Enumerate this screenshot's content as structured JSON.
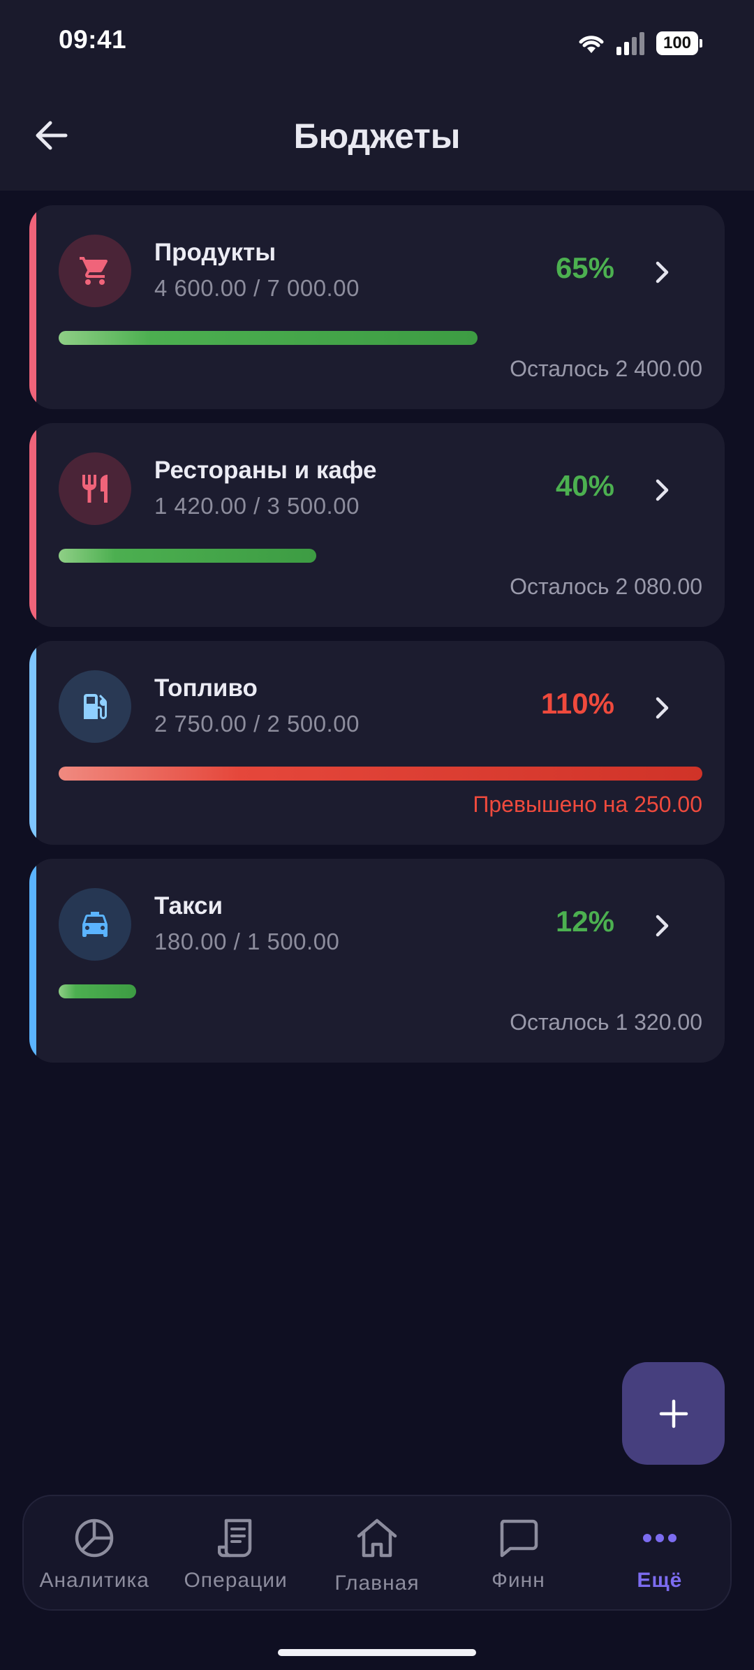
{
  "status_bar": {
    "time": "09:41",
    "battery": "100"
  },
  "header": {
    "title": "Бюджеты"
  },
  "budgets": [
    {
      "name": "Продукты",
      "amount": "4 600.00 / 7 000.00",
      "percent_label": "65%",
      "progress": 0.65,
      "remainder": "Осталось 2 400.00",
      "status": "ok",
      "icon": "shopping-cart-icon",
      "accent_color": "#f0647a",
      "icon_color": "#f0647a",
      "icon_bg": "#4a2437"
    },
    {
      "name": "Рестораны и кафе",
      "amount": "1 420.00 / 3 500.00",
      "percent_label": "40%",
      "progress": 0.4,
      "remainder": "Осталось 2 080.00",
      "status": "ok",
      "icon": "fork-knife-icon",
      "accent_color": "#f0647a",
      "icon_color": "#f0647a",
      "icon_bg": "#4a2437"
    },
    {
      "name": "Топливо",
      "amount": "2 750.00 / 2 500.00",
      "percent_label": "110%",
      "progress": 1.1,
      "remainder": "Превышено на 250.00",
      "status": "over",
      "icon": "fuel-pump-icon",
      "accent_color": "#7fc6ff",
      "icon_color": "#8fd0ff",
      "icon_bg": "#293954"
    },
    {
      "name": "Такси",
      "amount": "180.00 / 1 500.00",
      "percent_label": "12%",
      "progress": 0.12,
      "remainder": "Осталось 1 320.00",
      "status": "ok",
      "icon": "taxi-icon",
      "accent_color": "#5bb4ff",
      "icon_color": "#5bb4ff",
      "icon_bg": "#263753"
    }
  ],
  "colors": {
    "ok_percent": "#4cb050",
    "over_percent": "#ef4a3d",
    "accent": "#7c6cf0"
  },
  "fab": {
    "icon": "plus-icon"
  },
  "nav": {
    "analytics": "Аналитика",
    "operations": "Операции",
    "home": "Главная",
    "finn": "Финн",
    "more": "Ещё"
  }
}
